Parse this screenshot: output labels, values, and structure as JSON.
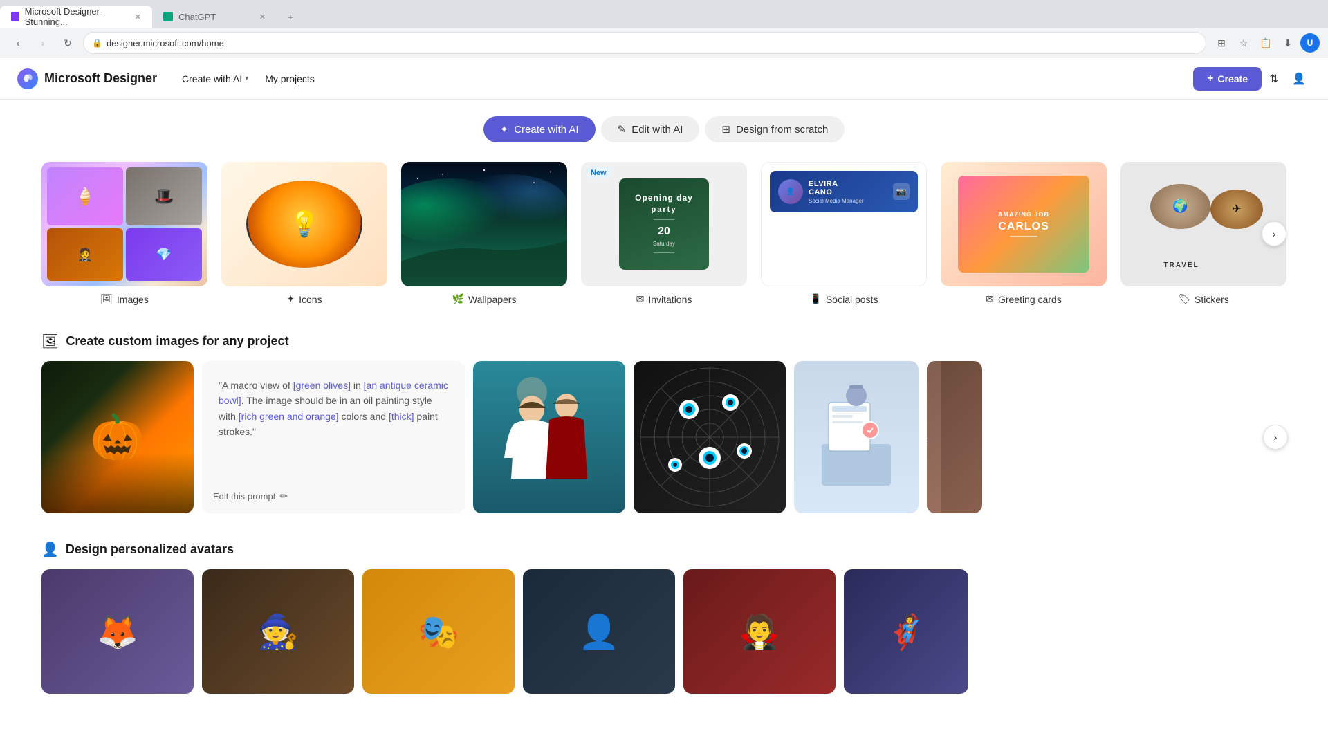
{
  "browser": {
    "tabs": [
      {
        "id": "tab1",
        "title": "Microsoft Designer - Stunning...",
        "favicon_type": "ms-designer",
        "active": true
      },
      {
        "id": "tab2",
        "title": "ChatGPT",
        "favicon_type": "chatgpt",
        "active": false
      }
    ],
    "new_tab_label": "+",
    "address": "designer.microsoft.com/home",
    "back_disabled": false,
    "forward_disabled": true
  },
  "header": {
    "logo_text": "Microsoft Designer",
    "nav_items": [
      {
        "id": "create-with-ai",
        "label": "Create with AI",
        "has_dropdown": true
      },
      {
        "id": "my-projects",
        "label": "My projects",
        "has_dropdown": false
      }
    ],
    "create_button": "+ Create",
    "profile_initial": "U"
  },
  "tabs": [
    {
      "id": "create-with-ai-tab",
      "label": "Create with AI",
      "icon": "✦",
      "active": true
    },
    {
      "id": "edit-with-ai-tab",
      "label": "Edit with AI",
      "icon": "✎",
      "active": false
    },
    {
      "id": "design-from-scratch-tab",
      "label": "Design from scratch",
      "icon": "⊞",
      "active": false
    }
  ],
  "categories": [
    {
      "id": "images",
      "label": "Images",
      "icon": "🖼",
      "style": "img-images",
      "new": false
    },
    {
      "id": "icons",
      "label": "Icons",
      "icon": "✦",
      "style": "img-icons",
      "new": false
    },
    {
      "id": "wallpapers",
      "label": "Wallpapers",
      "icon": "🌿",
      "style": "img-wallpapers",
      "new": false
    },
    {
      "id": "invitations",
      "label": "Invitations",
      "icon": "✉",
      "style": "img-invitations",
      "new": true
    },
    {
      "id": "social-posts",
      "label": "Social posts",
      "icon": "📱",
      "style": "img-social",
      "new": false
    },
    {
      "id": "greeting-cards",
      "label": "Greeting cards",
      "icon": "✉",
      "style": "img-greeting",
      "new": false
    },
    {
      "id": "stickers",
      "label": "Stickers",
      "icon": "🏷",
      "style": "img-stickers",
      "new": false
    }
  ],
  "custom_images_section": {
    "icon": "🖼",
    "title": "Create custom images for any project",
    "prompt_text_parts": [
      {
        "type": "normal",
        "text": "\"A macro view of "
      },
      {
        "type": "highlight",
        "text": "[green olives]"
      },
      {
        "type": "normal",
        "text": " in "
      },
      {
        "type": "highlight",
        "text": "[an antique ceramic bowl]"
      },
      {
        "type": "normal",
        "text": ". The image should be in an oil painting style with "
      },
      {
        "type": "highlight",
        "text": "[rich green and orange]"
      },
      {
        "type": "normal",
        "text": " colors and "
      },
      {
        "type": "highlight",
        "text": "[thick]"
      },
      {
        "type": "normal",
        "text": " paint strokes.\""
      }
    ],
    "edit_prompt_label": "Edit this prompt"
  },
  "avatars_section": {
    "icon": "👤",
    "title": "Design personalized avatars"
  },
  "next_button_label": "›"
}
